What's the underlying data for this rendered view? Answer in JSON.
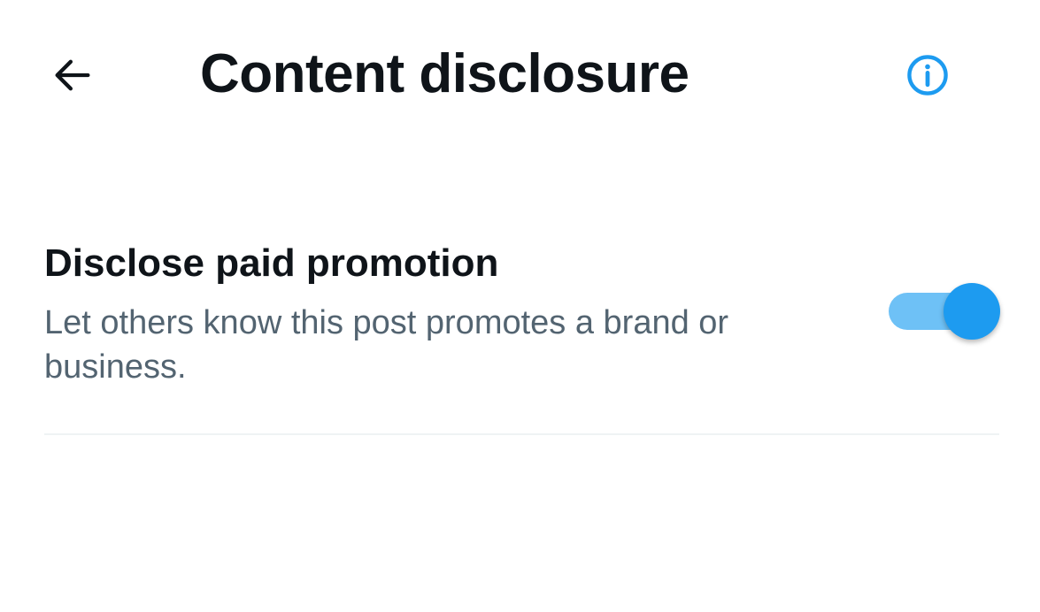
{
  "header": {
    "back_icon": "arrow-left-icon",
    "title": "Content disclosure",
    "info_icon": "info-circle-icon"
  },
  "setting": {
    "title": "Disclose paid promotion",
    "description": "Let others know this post promotes a brand or business.",
    "toggle_on": true
  },
  "colors": {
    "accent": "#1d9bf0",
    "accent_track": "#6ec1f6",
    "primary_text": "#0f1419",
    "secondary_text": "#536471",
    "divider": "#eff3f4"
  }
}
